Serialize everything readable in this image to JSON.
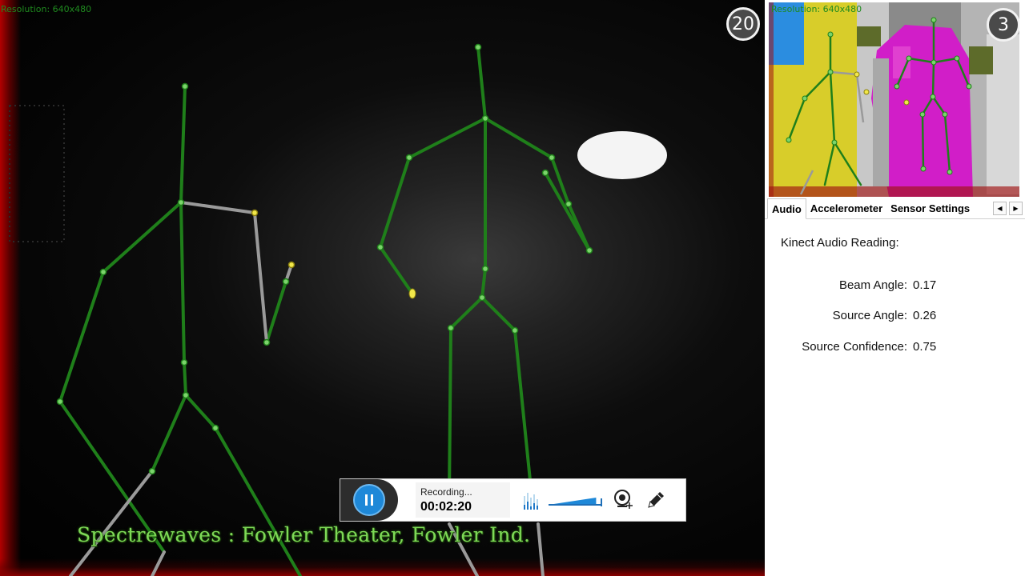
{
  "main_view": {
    "resolution_label": "Resolution: 640x480",
    "tracked_joints_count": "20",
    "caption": "Spectrewaves : Fowler Theater, Fowler Ind."
  },
  "preview": {
    "resolution_label": "Resolution: 640x480",
    "player_count": "3"
  },
  "recorder": {
    "status": "Recording...",
    "elapsed": "00:02:20",
    "volume_level": 0.9
  },
  "tabs": [
    {
      "label": "Audio",
      "active": true
    },
    {
      "label": "Accelerometer",
      "active": false
    },
    {
      "label": "Sensor Settings",
      "active": false
    }
  ],
  "audio": {
    "title": "Kinect Audio Reading:",
    "readings": [
      {
        "label": "Beam Angle:",
        "value": "0.17"
      },
      {
        "label": "Source Angle:",
        "value": "0.26"
      },
      {
        "label": "Source Confidence:",
        "value": "0.75"
      }
    ]
  },
  "colors": {
    "bone_tracked": "#1f7f1a",
    "bone_inferred": "#9a9a9a",
    "joint_tracked": "#7bd46b",
    "joint_inferred": "#f2e84a",
    "caption": "#7ed957",
    "record_button": "#1e88d8"
  }
}
